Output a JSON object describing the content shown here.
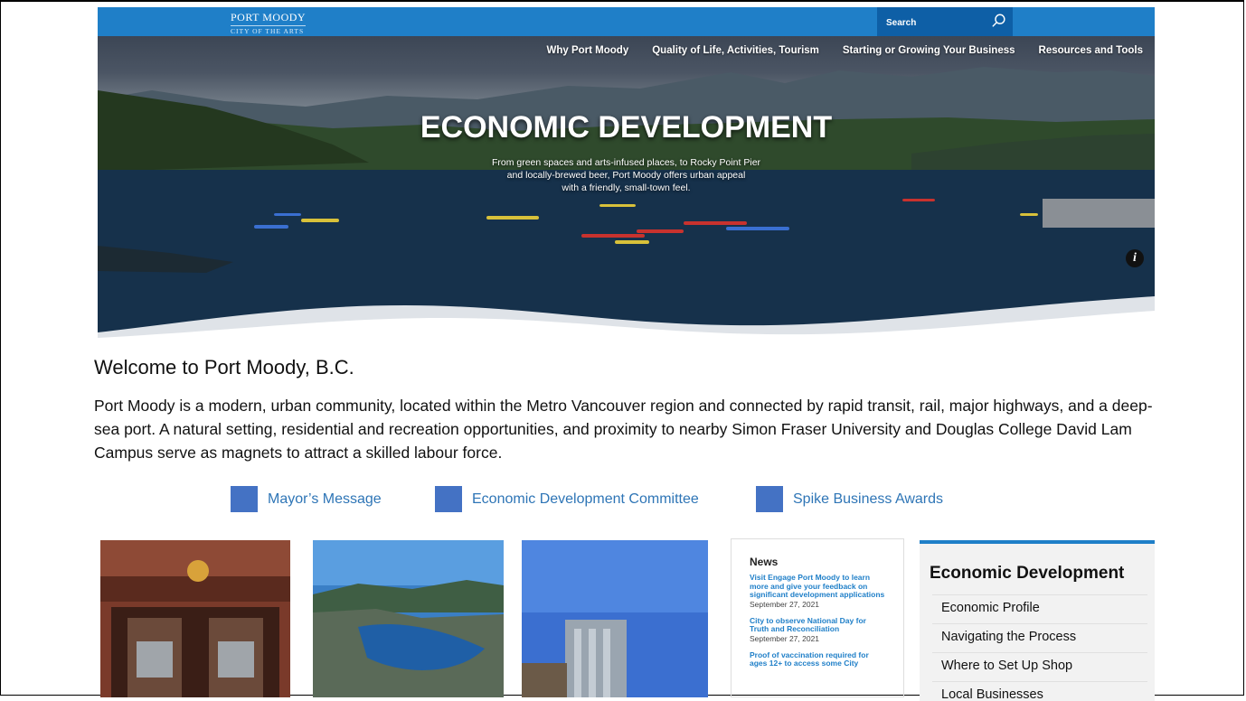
{
  "header": {
    "logo_line1": "PORT MOODY",
    "logo_line2": "CITY OF THE ARTS",
    "search_placeholder": "Search"
  },
  "nav": {
    "items": [
      {
        "label": "Why Port Moody"
      },
      {
        "label": "Quality of Life, Activities, Tourism"
      },
      {
        "label": "Starting or Growing Your Business"
      },
      {
        "label": "Resources and Tools"
      }
    ]
  },
  "hero": {
    "title": "ECONOMIC DEVELOPMENT",
    "subtitle_line1": "From green spaces and arts-infused places, to Rocky Point Pier",
    "subtitle_line2": "and locally-brewed beer, Port Moody offers urban appeal",
    "subtitle_line3": "with a friendly, small-town feel.",
    "info_label": "i"
  },
  "welcome": {
    "title": "Welcome to Port Moody, B.C.",
    "body": "Port Moody is a modern, urban community, located within the Metro Vancouver region and connected by rapid transit, rail, major highways, and a deep-sea port. A natural setting, residential and recreation opportunities, and proximity to nearby Simon Fraser University and Douglas College David Lam Campus serve as magnets to attract a skilled labour force."
  },
  "quick_links": [
    {
      "label": "Mayor’s Message"
    },
    {
      "label": "Economic Development Committee"
    },
    {
      "label": "Spike Business Awards"
    }
  ],
  "news": {
    "heading": "News",
    "items": [
      {
        "title": "Visit Engage Port Moody to learn more and give your feedback on significant development applications",
        "date": "September 27, 2021"
      },
      {
        "title": "City to observe National Day for Truth and Reconciliation",
        "date": "September 27, 2021"
      },
      {
        "title": "Proof of vaccination required for ages 12+ to access some City",
        "date": ""
      }
    ]
  },
  "econ_menu": {
    "heading": "Economic Development",
    "items": [
      {
        "label": "Economic Profile"
      },
      {
        "label": "Navigating the Process"
      },
      {
        "label": "Where to Set Up Shop"
      },
      {
        "label": "Local Businesses"
      }
    ]
  },
  "colors": {
    "brand_blue": "#1f7fc8",
    "link_blue": "#2e75b6",
    "bullet_blue": "#4472c4"
  }
}
